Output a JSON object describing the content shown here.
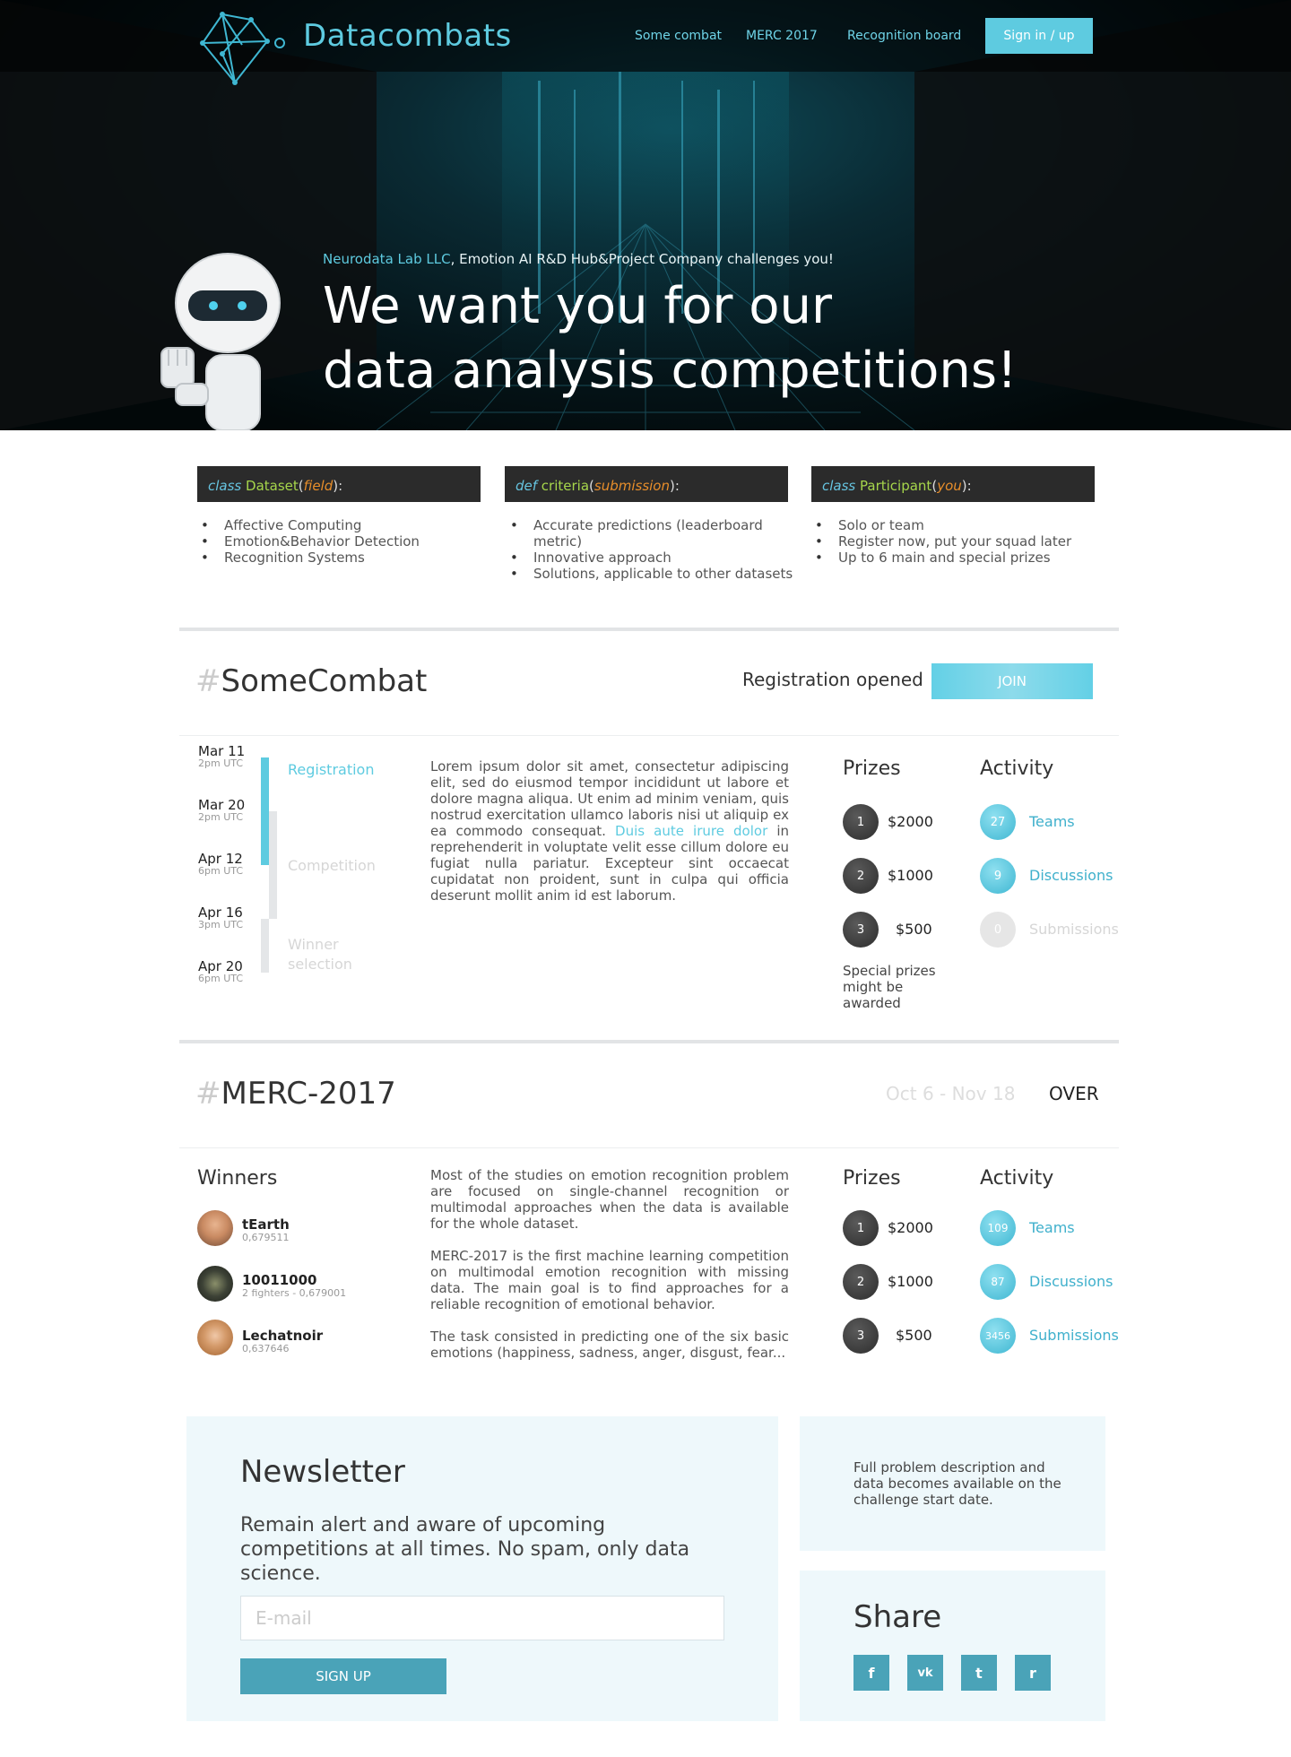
{
  "header": {
    "logo_text": "Datacombats",
    "nav": [
      "Some combat",
      "MERC  2017",
      "Recognition board"
    ],
    "signin_label": "Sign in / up"
  },
  "hero": {
    "sub_accent": "Neurodata Lab LLC",
    "sub_rest": ", Emotion AI R&D Hub&Project Company challenges you!",
    "title_line1": "We want you for our",
    "title_line2": "data analysis competitions!"
  },
  "features": [
    {
      "kw": "class",
      "name": " Dataset",
      "arg": "field",
      "items": [
        "Affective Computing",
        "Emotion&Behavior Detection",
        "Recognition Systems"
      ]
    },
    {
      "kw": "def",
      "name": " criteria",
      "arg": "submission",
      "items": [
        "Accurate predictions (leaderboard metric)",
        "Innovative approach",
        "Solutions, applicable to other datasets"
      ]
    },
    {
      "kw": "class",
      "name": " Participant",
      "arg": "you",
      "items": [
        "Solo or team",
        "Register now, put your squad later",
        "Up to 6 main and special prizes"
      ]
    }
  ],
  "combat": {
    "hash": "#",
    "title": "SomeCombat",
    "status": "Registration opened",
    "join_label": "JOIN",
    "timeline": [
      {
        "date": "Mar 11",
        "time": "2pm UTC"
      },
      {
        "date": "Mar 20",
        "time": "2pm UTC"
      },
      {
        "date": "Apr 12",
        "time": "6pm UTC"
      },
      {
        "date": "Apr 16",
        "time": "3pm UTC"
      },
      {
        "date": "Apr 20",
        "time": "6pm UTC"
      }
    ],
    "stages": [
      "Registration",
      "Competition",
      "Winner",
      "selection"
    ],
    "text_before": "Lorem ipsum dolor sit amet, consectetur adipiscing elit, sed do eiusmod tempor incididunt ut labore et dolore magna aliqua. Ut enim ad minim veniam, quis nostrud exercitation ullamco laboris nisi ut aliquip ex ea commodo consequat. ",
    "text_link": "Duis aute irure dolor",
    "text_after": " in reprehenderit in voluptate velit esse cillum dolore eu fugiat nulla pariatur. Excepteur sint occaecat cupidatat non proident, sunt in culpa qui officia deserunt mollit anim id est laborum.",
    "prizes_title": "Prizes",
    "prizes": [
      {
        "rank": "1",
        "value": "$2000"
      },
      {
        "rank": "2",
        "value": "$1000"
      },
      {
        "rank": "3",
        "value": "$500"
      }
    ],
    "special": "Special prizes might be awarded",
    "activity_title": "Activity",
    "activity": [
      {
        "count": "27",
        "label": "Teams"
      },
      {
        "count": "9",
        "label": "Discussions"
      },
      {
        "count": "0",
        "label": "Submissions"
      }
    ]
  },
  "merc": {
    "hash": "#",
    "title": "MERC-2017",
    "dates": "Oct 6 - Nov 18",
    "status": "OVER",
    "winners_title": "Winners",
    "winners": [
      {
        "name": "tEarth",
        "score": "0,679511"
      },
      {
        "name": "10011000",
        "score": "2 fighters - 0,679001"
      },
      {
        "name": "Lechatnoir",
        "score": "0,637646"
      }
    ],
    "p1": "Most of the studies on emotion recognition problem are focused on single-channel recognition or multimodal approaches when the data is available for the whole dataset.",
    "p2": "MERC-2017 is the first machine learning competition on multimodal emotion recognition with missing data. The main goal is to find approaches for a reliable recognition of emotional behavior.",
    "p3": "The task consisted in predicting one of the six basic emotions (happiness, sadness, anger, disgust, fear...",
    "prizes_title": "Prizes",
    "prizes": [
      {
        "rank": "1",
        "value": "$2000"
      },
      {
        "rank": "2",
        "value": "$1000"
      },
      {
        "rank": "3",
        "value": "$500"
      }
    ],
    "activity_title": "Activity",
    "activity": [
      {
        "count": "109",
        "label": "Teams"
      },
      {
        "count": "87",
        "label": "Discussions"
      },
      {
        "count": "3456",
        "label": "Submissions"
      }
    ]
  },
  "newsletter": {
    "title": "Newsletter",
    "text": "Remain alert and aware of upcoming competitions at all times. No spam, only data science.",
    "placeholder": "E-mail",
    "signup_label": "SIGN UP"
  },
  "info": {
    "text": "Full problem description and data becomes available on the challenge start date."
  },
  "share": {
    "title": "Share",
    "icons": [
      "facebook-icon",
      "vk-icon",
      "twitter-icon",
      "reddit-icon"
    ],
    "glyphs": [
      "f",
      "vk",
      "t",
      "r"
    ]
  },
  "colors": {
    "accent": "#5ecbe0",
    "button_dark": "#4aa3b8",
    "panel_bg": "#eef8fb",
    "code_bg": "#2b2b2b"
  }
}
